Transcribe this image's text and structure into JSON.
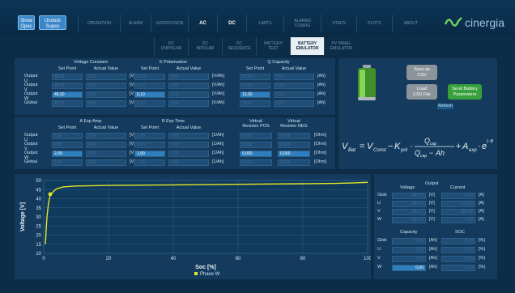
{
  "top": {
    "show_open": "Show\nOpec",
    "undock": "Undock\nSupes",
    "tabs": [
      "OPERATION",
      "ALARM",
      "SUPERVISION",
      "AC",
      "DC",
      "LIMITS",
      "ALARMS\nCONFIG",
      "STEPS",
      "PLOTS",
      "ABOUT"
    ],
    "active_tabs": [
      "AC",
      "DC"
    ],
    "brand": "cinergia"
  },
  "subtabs": [
    "DC\nUNIPOLAR",
    "DC\nBIPOLAR",
    "DC\nSEQUENCE",
    "BATTERY\nTEST",
    "BATTERY\nEMULATOR",
    "PV PANEL\nEMULATOR"
  ],
  "active_subtab": "BATTERY\nEMULATOR",
  "row_labels": [
    "Output U",
    "Output V",
    "Output W",
    "Global"
  ],
  "voltage_constant": {
    "title": "Voltage Constant",
    "sp": "Set Point",
    "av": "Actual Value",
    "unit": "[V]",
    "set": [
      "48,00",
      "48,00",
      "48,00",
      "48,00"
    ],
    "act": [
      "0,00",
      "0,00",
      "0,00",
      "0,00"
    ]
  },
  "k_polarisation": {
    "title": "K Polarisation",
    "sp": "Set Point",
    "av": "Actual Value",
    "unit": "[V/Ah]",
    "set": [
      "0,10",
      "0,10",
      "0,10",
      "0,10"
    ],
    "act": [
      "0,00",
      "0,00",
      "0,00",
      "0,00"
    ]
  },
  "q_capacity": {
    "title": "Q Capacity",
    "sp": "Set Point",
    "av": "Actual Value",
    "unit": "[Ah]",
    "set": [
      "10,00",
      "10,00",
      "10,00",
      "10,00"
    ],
    "act": [
      "0,00",
      "0,00",
      "0,00",
      "0,00"
    ]
  },
  "a_exp_amp": {
    "title": "A Exp Amp",
    "sp": "Set Point",
    "av": "Actual Value",
    "unit": "[V]",
    "set": [
      "2,00",
      "2,00",
      "2,00",
      "2,00"
    ],
    "act": [
      "0,00",
      "0,00",
      "0,00",
      "0,00"
    ]
  },
  "b_exp_time": {
    "title": "B Exp Time",
    "sp": "Set Point",
    "av": "Actual Value",
    "unit": "[1/Ah]",
    "set": [
      "1,00",
      "1,00",
      "1,00",
      "1,00"
    ],
    "act": [
      "0,00",
      "0,00",
      "0,00",
      "0,00"
    ]
  },
  "virtual_resistor": {
    "pos_title": "Virtual\nResistor POS",
    "neg_title": "Virtual\nResistor NEG",
    "unit": "[Ohm]",
    "pos": [
      "0,000",
      "0,000",
      "0,000",
      "0,000"
    ],
    "neg": [
      "0,000",
      "0,000",
      "0,000",
      "0,000"
    ]
  },
  "buttons": {
    "save_csv": "Save as\nCSV",
    "load_csv": "Load\nCSV File",
    "send": "Send Battery\nParameters",
    "refresh": "Refresh"
  },
  "output": {
    "title": "Output",
    "voltage_hdr": "Voltage",
    "current_hdr": "Current",
    "rows": [
      "Glob",
      "U",
      "V",
      "W"
    ],
    "voltage": [
      "360,57",
      "360,87",
      "360,17",
      "360,17"
    ],
    "current": [
      "0,00",
      "210,00",
      "280,00",
      "0,00"
    ],
    "vunit": "[V]",
    "aunit": "[A]",
    "capacity_hdr": "Capacity",
    "soc_hdr": "SOC",
    "capacity": [
      "0,00",
      "0,00",
      "0,00",
      "0,00"
    ],
    "soc": [
      "0,00",
      "0,00",
      "0,00",
      "0,00"
    ],
    "cunit": "[Ah]",
    "sunit": "[%]"
  },
  "chart_data": {
    "type": "line",
    "xlabel": "Soc [%]",
    "ylabel": "Voltage [V]",
    "xlim": [
      0,
      100
    ],
    "ylim": [
      10,
      50
    ],
    "xticks": [
      0,
      20,
      40,
      60,
      80,
      100
    ],
    "yticks": [
      10,
      15,
      20,
      25,
      30,
      35,
      40,
      45,
      50
    ],
    "grid": true,
    "legend_placement": "bottom-center",
    "series": [
      {
        "name": "Phase W",
        "color": "#e6e62a",
        "x": [
          0.5,
          1,
          1.5,
          2,
          3,
          4,
          6,
          10,
          20,
          40,
          60,
          80,
          90,
          95,
          100
        ],
        "y": [
          15,
          30,
          38,
          42,
          44,
          45.5,
          46.5,
          47,
          47.3,
          47.6,
          47.9,
          48.2,
          48.4,
          48.6,
          49
        ]
      }
    ],
    "marker": {
      "x": 2,
      "y": 42.5
    }
  }
}
